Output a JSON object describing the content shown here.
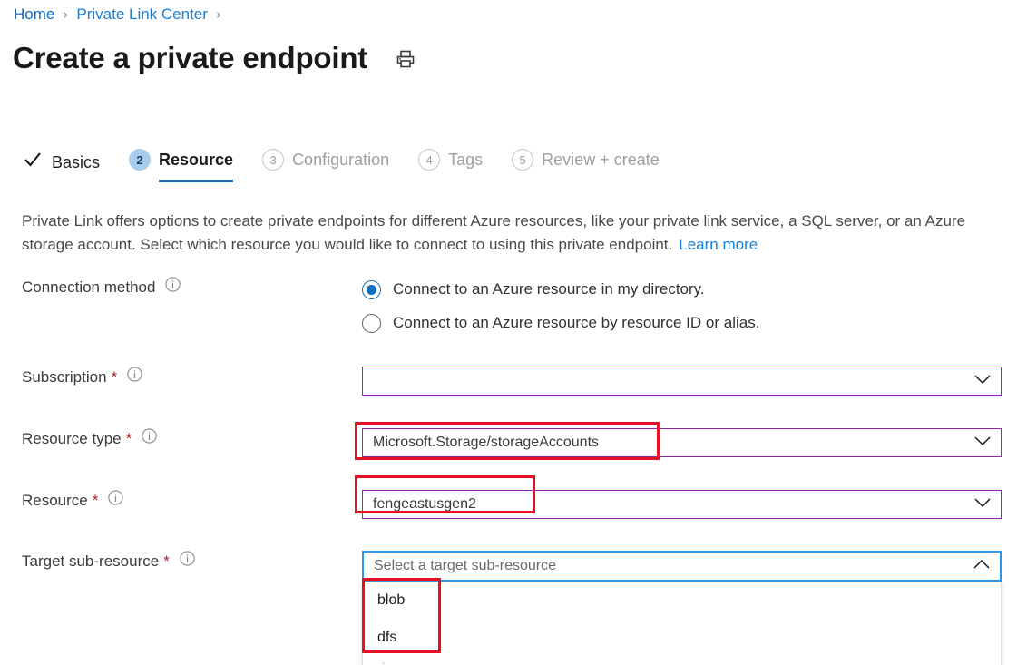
{
  "breadcrumb": {
    "items": [
      {
        "label": "Home"
      },
      {
        "label": "Private Link Center"
      }
    ],
    "separator": "›"
  },
  "header": {
    "title": "Create a private endpoint",
    "print_icon": "print-icon"
  },
  "tabs": [
    {
      "num": "✓",
      "label": "Basics",
      "state": "done"
    },
    {
      "num": "2",
      "label": "Resource",
      "state": "active"
    },
    {
      "num": "3",
      "label": "Configuration",
      "state": "todo"
    },
    {
      "num": "4",
      "label": "Tags",
      "state": "todo"
    },
    {
      "num": "5",
      "label": "Review + create",
      "state": "todo"
    }
  ],
  "description": {
    "text": "Private Link offers options to create private endpoints for different Azure resources, like your private link service, a SQL server, or an Azure storage account. Select which resource you would like to connect to using this private endpoint.",
    "link_label": "Learn more"
  },
  "form": {
    "connection_method": {
      "label": "Connection method",
      "info_icon": "info-icon",
      "options": [
        {
          "label": "Connect to an Azure resource in my directory.",
          "selected": true
        },
        {
          "label": "Connect to an Azure resource by resource ID or alias.",
          "selected": false
        }
      ]
    },
    "subscription": {
      "label": "Subscription",
      "required": "*",
      "info_icon": "info-icon",
      "value": "",
      "chevron": "chevron-down-icon"
    },
    "resource_type": {
      "label": "Resource type",
      "required": "*",
      "info_icon": "info-icon",
      "value": "Microsoft.Storage/storageAccounts",
      "chevron": "chevron-down-icon",
      "highlighted": true
    },
    "resource": {
      "label": "Resource",
      "required": "*",
      "info_icon": "info-icon",
      "value": "fengeastusgen2",
      "chevron": "chevron-down-icon",
      "highlighted": true
    },
    "target_sub_resource": {
      "label": "Target sub-resource",
      "required": "*",
      "info_icon": "info-icon",
      "placeholder": "Select a target sub-resource",
      "chevron": "chevron-up-icon",
      "expanded": true,
      "options": [
        {
          "label": "blob"
        },
        {
          "label": "dfs"
        }
      ]
    }
  },
  "colors": {
    "link_blue": "#0f6cbd",
    "accent_blue": "#2899f5",
    "field_purple": "#9327b0",
    "annotation_red": "#e81123",
    "required_red": "#a4262c",
    "tab_active_circle": "#a8cdea"
  }
}
